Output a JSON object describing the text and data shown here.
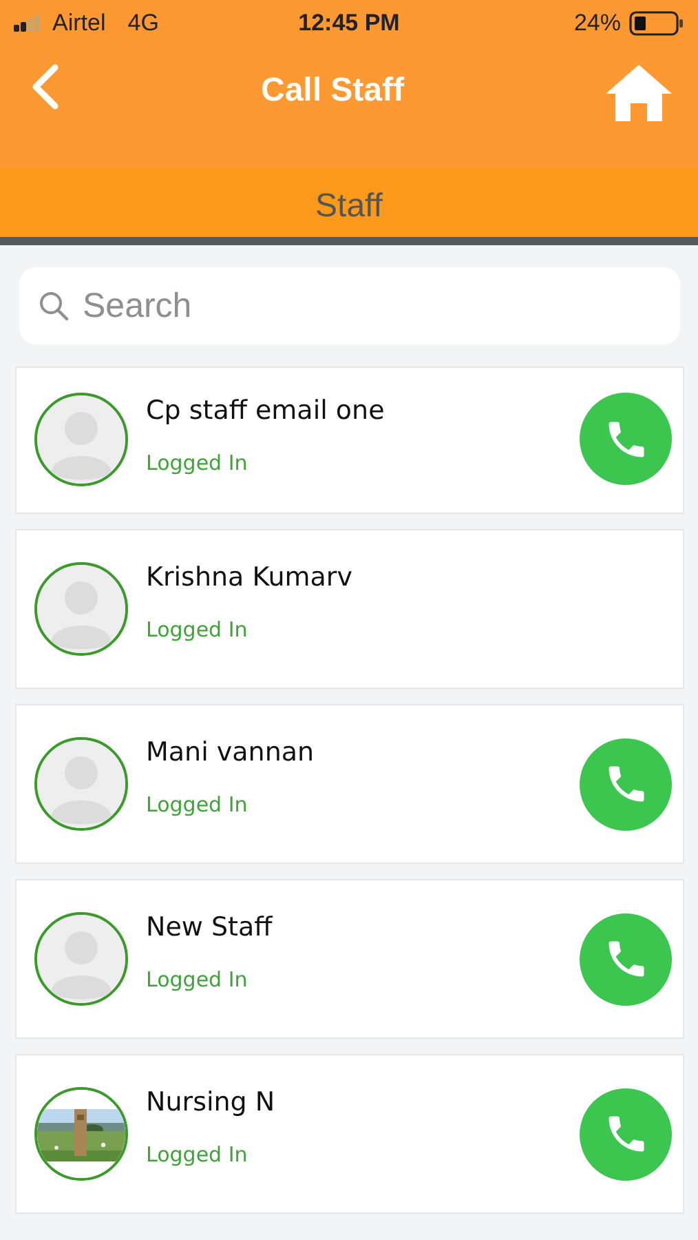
{
  "status_bar": {
    "carrier": "Airtel",
    "network": "4G",
    "time": "12:45 PM",
    "battery": "24%"
  },
  "nav": {
    "title": "Call Staff"
  },
  "tabs": [
    {
      "label": "Staff",
      "selected": true
    }
  ],
  "search": {
    "placeholder": "Search"
  },
  "staff": [
    {
      "name": "Cp staff email one",
      "status": "Logged In",
      "kind": "placeholder",
      "callable": true
    },
    {
      "name": "Krishna Kumarv",
      "status": "Logged In",
      "kind": "placeholder",
      "callable": false
    },
    {
      "name": "Mani vannan",
      "status": "Logged In",
      "kind": "placeholder",
      "callable": true
    },
    {
      "name": "New Staff",
      "status": "Logged In",
      "kind": "placeholder",
      "callable": true
    },
    {
      "name": "Nursing N",
      "status": "Logged In",
      "kind": "picture",
      "callable": true
    }
  ]
}
